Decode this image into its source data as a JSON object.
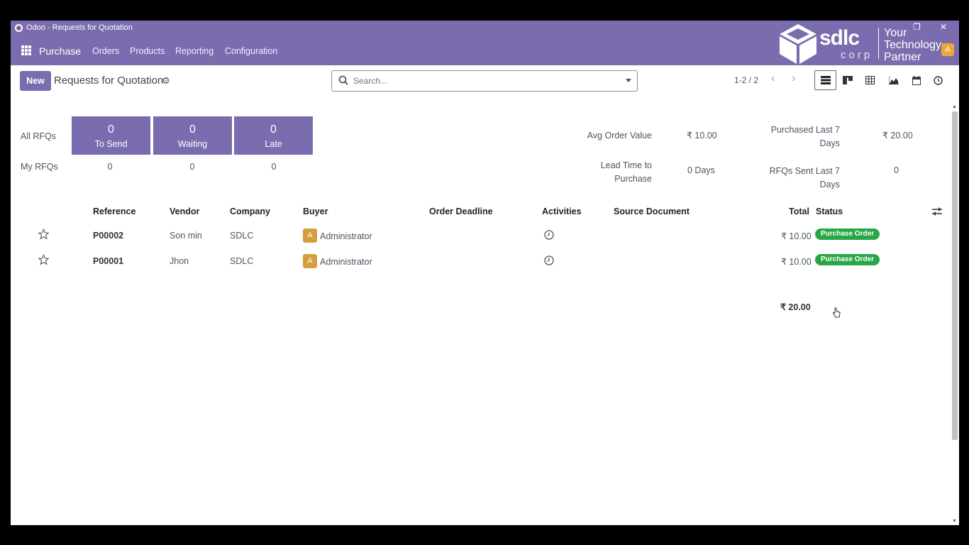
{
  "window": {
    "title": "Odoo - Requests for Quotation"
  },
  "navbar": {
    "brand": "Purchase",
    "menu": [
      "Orders",
      "Products",
      "Reporting",
      "Configuration"
    ],
    "avatar_letter": "A"
  },
  "watermark": {
    "logo": "sdlc",
    "sub": "corp",
    "tagline": [
      "Your",
      "Technology",
      "Partner"
    ]
  },
  "control": {
    "new_label": "New",
    "breadcrumb": "Requests for Quotation",
    "search_placeholder": "Search...",
    "pager": "1-2 / 2"
  },
  "dashboard": {
    "all_rfqs_label": "All RFQs",
    "my_rfqs_label": "My RFQs",
    "tiles": [
      {
        "count": "0",
        "label": "To Send"
      },
      {
        "count": "0",
        "label": "Waiting"
      },
      {
        "count": "0",
        "label": "Late"
      }
    ],
    "my_values": [
      "0",
      "0",
      "0"
    ],
    "kpis": {
      "avg_order_value": {
        "label": "Avg Order Value",
        "value": "₹ 10.00"
      },
      "purchased_last_7": {
        "label_1": "Purchased Last 7",
        "label_2": "Days",
        "value": "₹ 20.00"
      },
      "lead_time": {
        "label_1": "Lead Time to",
        "label_2": "Purchase",
        "value": "0  Days"
      },
      "rfqs_sent": {
        "label": "RFQs Sent Last 7 Days",
        "value": "0"
      }
    }
  },
  "table": {
    "headers": {
      "reference": "Reference",
      "vendor": "Vendor",
      "company": "Company",
      "buyer": "Buyer",
      "deadline": "Order Deadline",
      "activities": "Activities",
      "source": "Source Document",
      "total": "Total",
      "status": "Status"
    },
    "rows": [
      {
        "reference": "P00002",
        "vendor": "Son min",
        "company": "SDLC",
        "buyer_initial": "A",
        "buyer": "Administrator",
        "total": "₹ 10.00",
        "status": "Purchase Order"
      },
      {
        "reference": "P00001",
        "vendor": "Jhon",
        "company": "SDLC",
        "buyer_initial": "A",
        "buyer": "Administrator",
        "total": "₹ 10.00",
        "status": "Purchase Order"
      }
    ],
    "grand_total": "₹ 20.00"
  },
  "colors": {
    "brand": "#7a6cae",
    "status_green": "#28a745",
    "avatar": "#d69d3c"
  }
}
